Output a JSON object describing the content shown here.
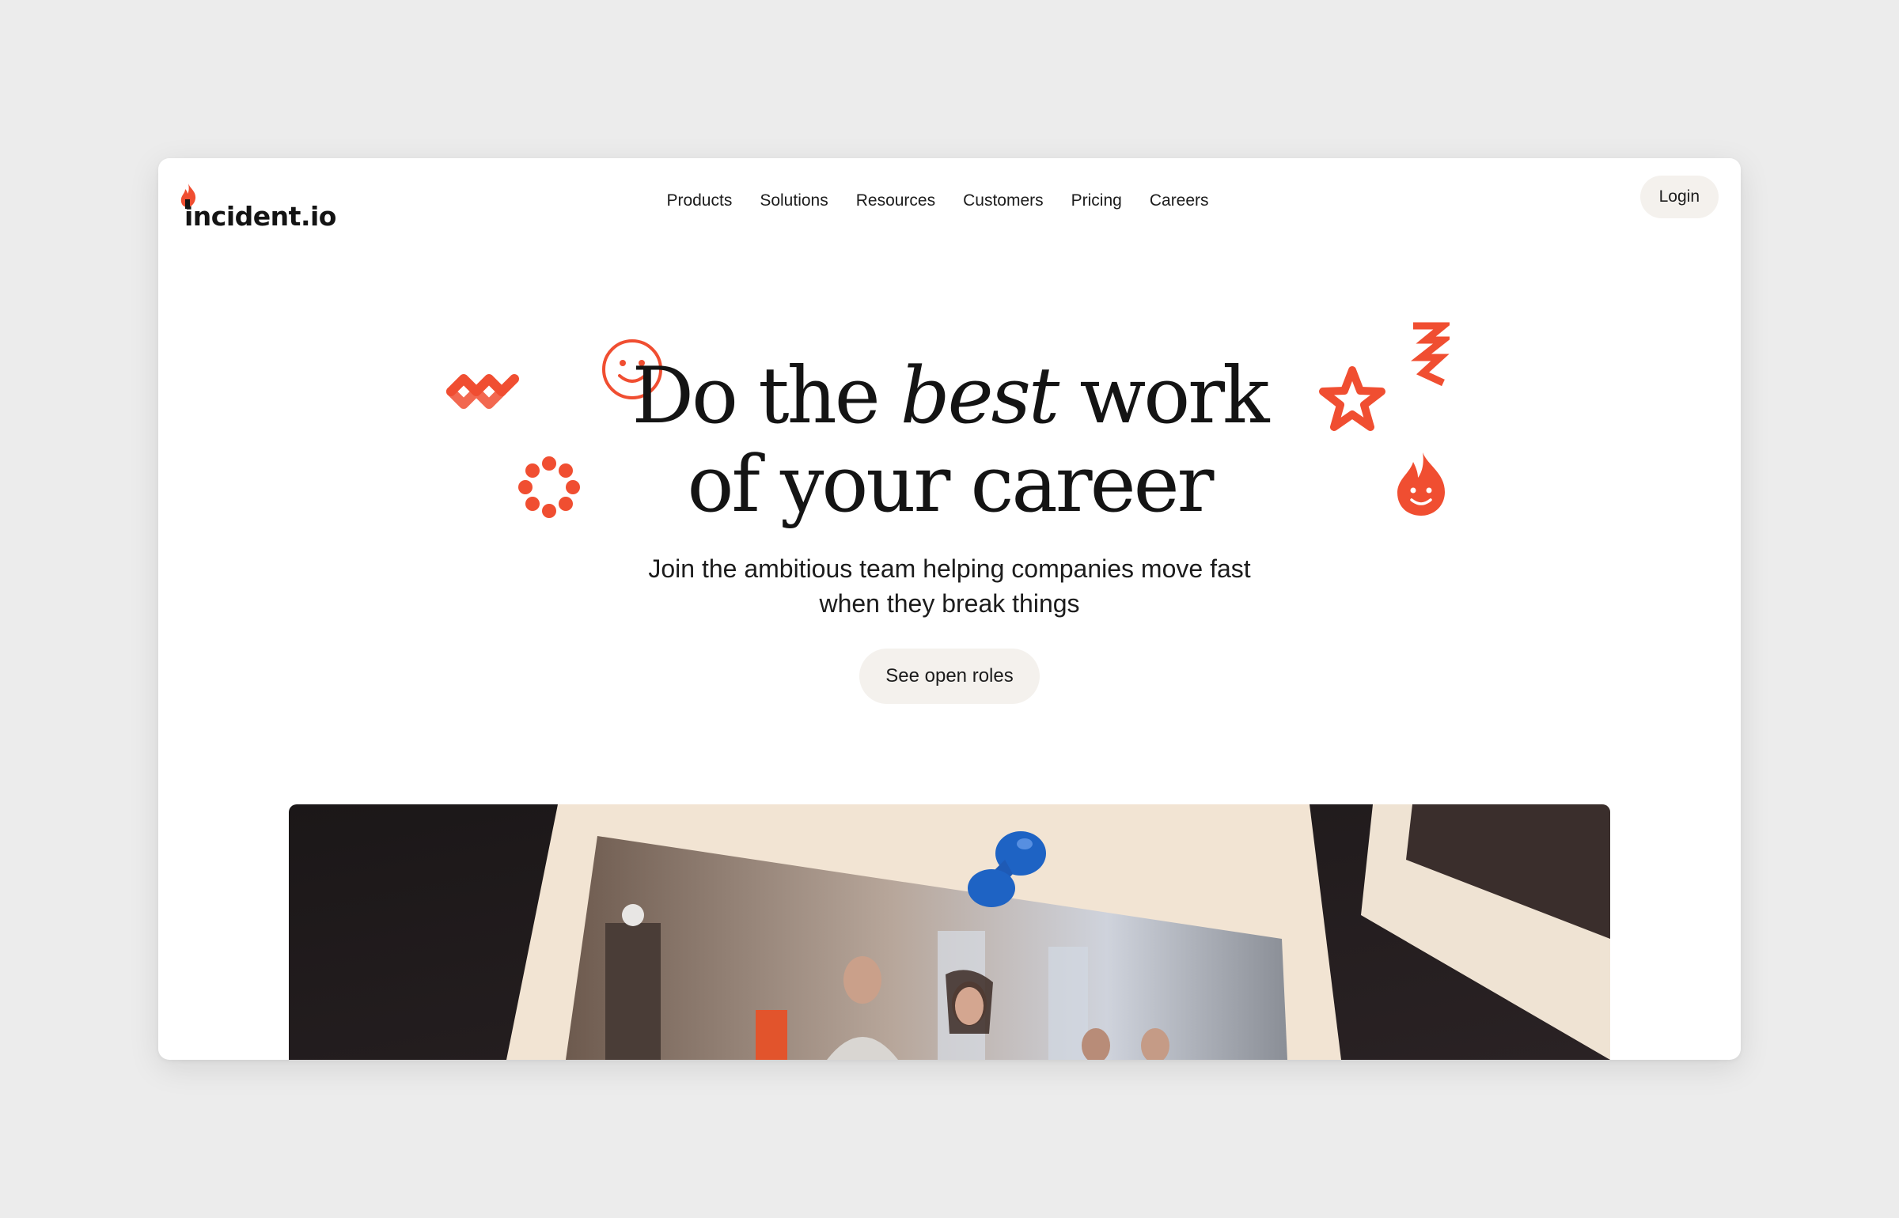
{
  "brand": {
    "logo_text": "incident.io",
    "accent": "#f04e31"
  },
  "nav": {
    "items": [
      {
        "label": "Products"
      },
      {
        "label": "Solutions"
      },
      {
        "label": "Resources"
      },
      {
        "label": "Customers"
      },
      {
        "label": "Pricing"
      },
      {
        "label": "Careers"
      }
    ],
    "login_label": "Login"
  },
  "hero": {
    "title_part1": "Do the ",
    "title_emphasis": "best",
    "title_part2": " work",
    "title_line2": "of your career",
    "subtitle_line1": "Join the ambitious team helping companies move fast",
    "subtitle_line2": "when they break things",
    "cta_label": "See open roles"
  },
  "decorations": {
    "icons": [
      "squiggle-icon",
      "smiley-circle-icon",
      "ring-icon",
      "star-icon",
      "zigzag-icon",
      "smiley-flame-icon"
    ]
  },
  "colors": {
    "page_bg": "#ececec",
    "card_bg": "#ffffff",
    "button_bg": "#f4f1ed",
    "text": "#141414",
    "accent": "#f04e31",
    "pin_blue": "#1e63c4"
  }
}
